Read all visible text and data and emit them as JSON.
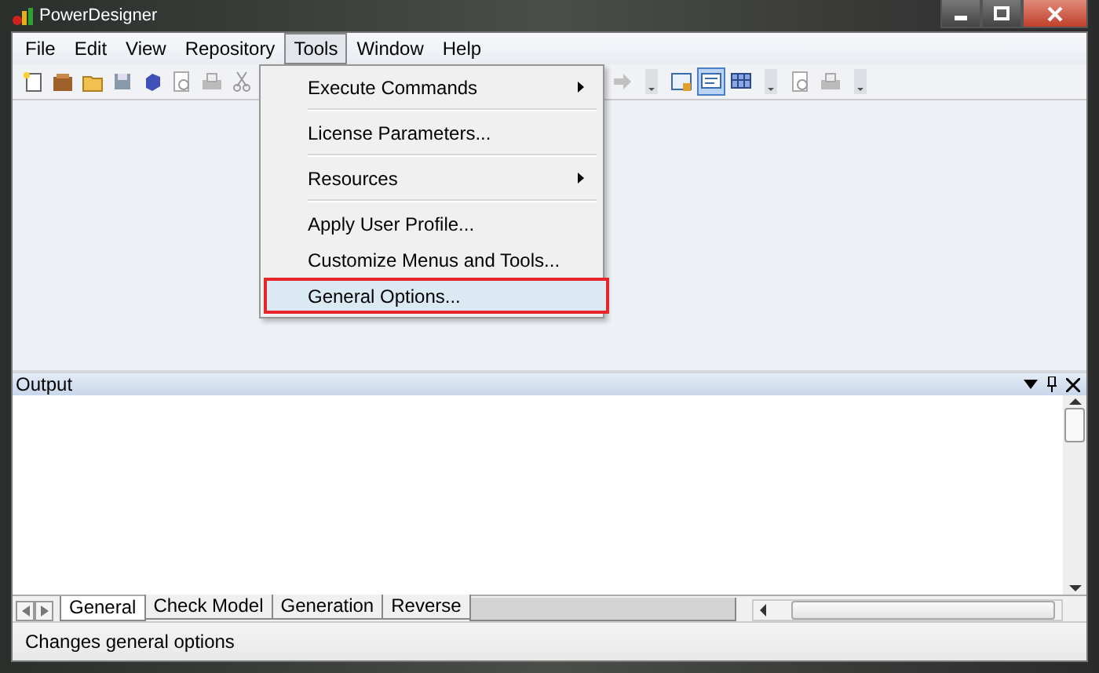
{
  "window": {
    "title": "PowerDesigner"
  },
  "menu_bar": [
    {
      "label": "File",
      "selected": false
    },
    {
      "label": "Edit",
      "selected": false
    },
    {
      "label": "View",
      "selected": false
    },
    {
      "label": "Repository",
      "selected": false
    },
    {
      "label": "Tools",
      "selected": true
    },
    {
      "label": "Window",
      "selected": false
    },
    {
      "label": "Help",
      "selected": false
    }
  ],
  "toolbar": {
    "groups": [
      [
        {
          "kind": "new",
          "selected": false
        },
        {
          "kind": "package",
          "selected": false
        },
        {
          "kind": "open",
          "selected": false
        },
        {
          "kind": "save",
          "selected": false
        },
        {
          "kind": "cube",
          "selected": false
        },
        {
          "kind": "preview",
          "selected": false
        },
        {
          "kind": "print",
          "selected": false
        },
        {
          "kind": "cut",
          "selected": false
        }
      ],
      [
        {
          "kind": "arrow",
          "selected": false
        },
        {
          "kind": "grip",
          "selected": false
        },
        {
          "kind": "browser",
          "selected": false
        },
        {
          "kind": "output",
          "selected": true
        },
        {
          "kind": "grid",
          "selected": false
        },
        {
          "kind": "grip",
          "selected": false
        },
        {
          "kind": "preview",
          "selected": false
        },
        {
          "kind": "print",
          "selected": false
        },
        {
          "kind": "grip",
          "selected": false
        }
      ]
    ]
  },
  "dropdown_menu": {
    "items": [
      {
        "label": "Execute Commands",
        "submenu": true,
        "selected": false,
        "separator_after": true,
        "marked": false
      },
      {
        "label": "License Parameters...",
        "submenu": false,
        "selected": false,
        "separator_after": true,
        "marked": false
      },
      {
        "label": "Resources",
        "submenu": true,
        "selected": false,
        "separator_after": true,
        "marked": false
      },
      {
        "label": "Apply User Profile...",
        "submenu": false,
        "selected": false,
        "separator_after": false,
        "marked": false
      },
      {
        "label": "Customize Menus and Tools...",
        "submenu": false,
        "selected": false,
        "separator_after": false,
        "marked": false
      },
      {
        "label": "General Options...",
        "submenu": false,
        "selected": true,
        "separator_after": false,
        "marked": true
      }
    ]
  },
  "output_panel": {
    "title": "Output",
    "tabs": [
      {
        "label": "General",
        "selected": true
      },
      {
        "label": "Check Model",
        "selected": false
      },
      {
        "label": "Generation",
        "selected": false
      },
      {
        "label": "Reverse",
        "selected": false
      }
    ]
  },
  "status_bar": {
    "text": "Changes general options"
  }
}
